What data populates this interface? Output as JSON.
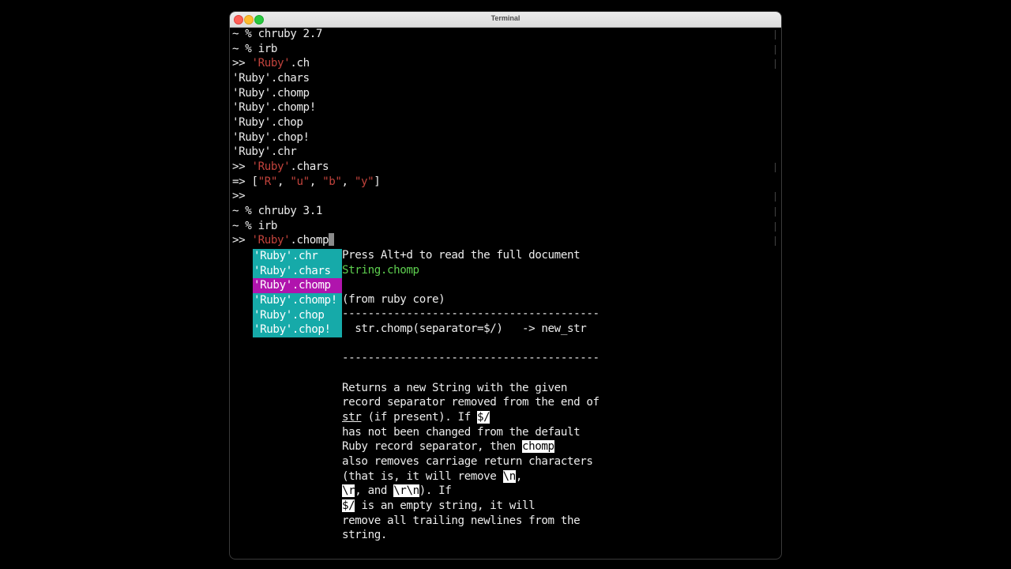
{
  "window": {
    "title": "Terminal"
  },
  "lines": [
    "~ % chruby 2.7",
    "~ % irb",
    "'Ruby'.chars",
    "'Ruby'.chomp",
    "'Ruby'.chomp!",
    "'Ruby'.chop",
    "'Ruby'.chop!",
    "'Ruby'.chr",
    "~ % chruby 3.1",
    "~ % irb"
  ],
  "prompt": ">>",
  "result_arrow": "=>",
  "input1": {
    "str": "'Ruby'",
    "method": ".ch"
  },
  "input2": {
    "str": "'Ruby'",
    "method": ".chars"
  },
  "result": {
    "open": "[",
    "items": [
      "\"R\"",
      "\"u\"",
      "\"b\"",
      "\"y\""
    ],
    "sep": ", ",
    "close": "]"
  },
  "input3": {
    "str": "'Ruby'",
    "method": ".chomp"
  },
  "completion": {
    "items": [
      "'Ruby'.chr",
      "'Ruby'.chars",
      "'Ruby'.chomp",
      "'Ruby'.chomp!",
      "'Ruby'.chop",
      "'Ruby'.chop!"
    ],
    "selected_index": 2
  },
  "doc": {
    "hint": "Press Alt+d to read the full document",
    "name": "String.chomp",
    "source": "(from ruby core)",
    "rule": "----------------------------------------",
    "signature": "  str.chomp(separator=$/)   -> new_str",
    "p1": "Returns a new String with the given",
    "p2": "record separator removed from the end of",
    "p3_a": "str",
    "p3_b": " (if present). If ",
    "p3_c": "$/",
    "p4": "has not been changed from the default",
    "p5_a": "Ruby record separator, then ",
    "p5_b": "chomp",
    "p6": "also removes carriage return characters",
    "p7_a": "(that is, it will remove ",
    "p7_b": "\\n",
    "p7_c": ",",
    "p8_a": "\\r",
    "p8_b": ", and ",
    "p8_c": "\\r\\n",
    "p8_d": "). If",
    "p9_a": "$/",
    "p9_b": " is an empty string, it will",
    "p10": "remove all trailing newlines from the",
    "p11": "string."
  },
  "colors": {
    "string_literal": "#c2433c",
    "completion_bg": "#16aaa9",
    "completion_selected_bg": "#b014ad",
    "doc_name": "#5ecf4f"
  }
}
